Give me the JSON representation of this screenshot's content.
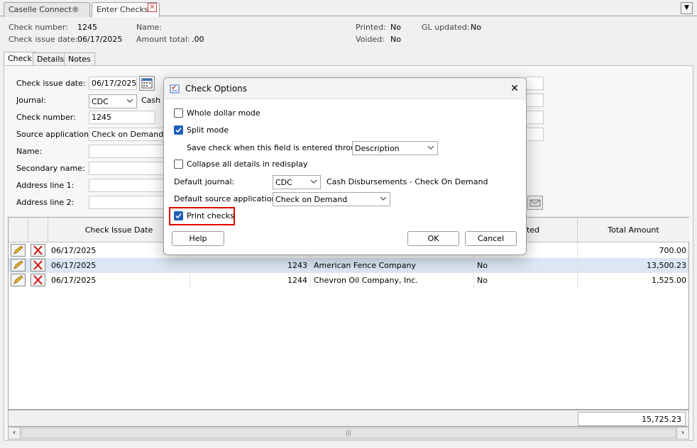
{
  "tabs": [
    {
      "label": "Caselle Connect®",
      "active": false
    },
    {
      "label": "Enter Checks",
      "active": true
    }
  ],
  "header": {
    "check_number_label": "Check number:",
    "check_number": "1245",
    "check_issue_date_label": "Check issue date:",
    "check_issue_date": "06/17/2025",
    "name_label": "Name:",
    "name": "",
    "amount_total_label": "Amount total:",
    "amount_total": ".00",
    "printed_label": "Printed:",
    "printed": "No",
    "voided_label": "Voided:",
    "voided": "No",
    "gl_updated_label": "GL updated:",
    "gl_updated": "No"
  },
  "subtabs": [
    "Check",
    "Details",
    "Notes"
  ],
  "form": {
    "check_issue_date_label": "Check issue date:",
    "check_issue_date": "06/17/2025",
    "journal_label": "Journal:",
    "journal": "CDC",
    "journal_desc": "Cash D",
    "check_number_label": "Check number:",
    "check_number": "1245",
    "source_app_label": "Source application:",
    "source_app": "Check on Demand",
    "name_label": "Name:",
    "secondary_name_label": "Secondary name:",
    "address1_label": "Address line 1:",
    "address2_label": "Address line 2:"
  },
  "grid": {
    "columns": [
      "Check Issue Date",
      "",
      "",
      "Printed",
      "Total Amount"
    ],
    "rows": [
      {
        "date": "06/17/2025",
        "check_no": "",
        "name": "",
        "printed": "",
        "amount": "700.00",
        "selected": false
      },
      {
        "date": "06/17/2025",
        "check_no": "1243",
        "name": "American Fence Company",
        "printed": "No",
        "amount": "13,500.23",
        "selected": true
      },
      {
        "date": "06/17/2025",
        "check_no": "1244",
        "name": "Chevron Oil Company, Inc.",
        "printed": "No",
        "amount": "1,525.00",
        "selected": false
      }
    ],
    "total": "15,725.23"
  },
  "dialog": {
    "title": "Check Options",
    "whole_dollar_label": "Whole dollar mode",
    "whole_dollar": false,
    "split_mode_label": "Split mode",
    "split_mode": true,
    "save_check_label": "Save check when this field is entered through:",
    "save_check_value": "Description",
    "collapse_label": "Collapse all details in redisplay",
    "collapse": false,
    "default_journal_label": "Default journal:",
    "default_journal": "CDC",
    "default_journal_desc": "Cash Disbursements - Check On Demand",
    "default_source_label": "Default source application:",
    "default_source": "Check on Demand",
    "print_checks_label": "Print checks",
    "print_checks": true,
    "help_label": "Help",
    "ok_label": "OK",
    "cancel_label": "Cancel"
  },
  "colors": {
    "accent": "#1e5fb8",
    "highlight": "#e00000",
    "selected_row": "#dce6f5"
  }
}
